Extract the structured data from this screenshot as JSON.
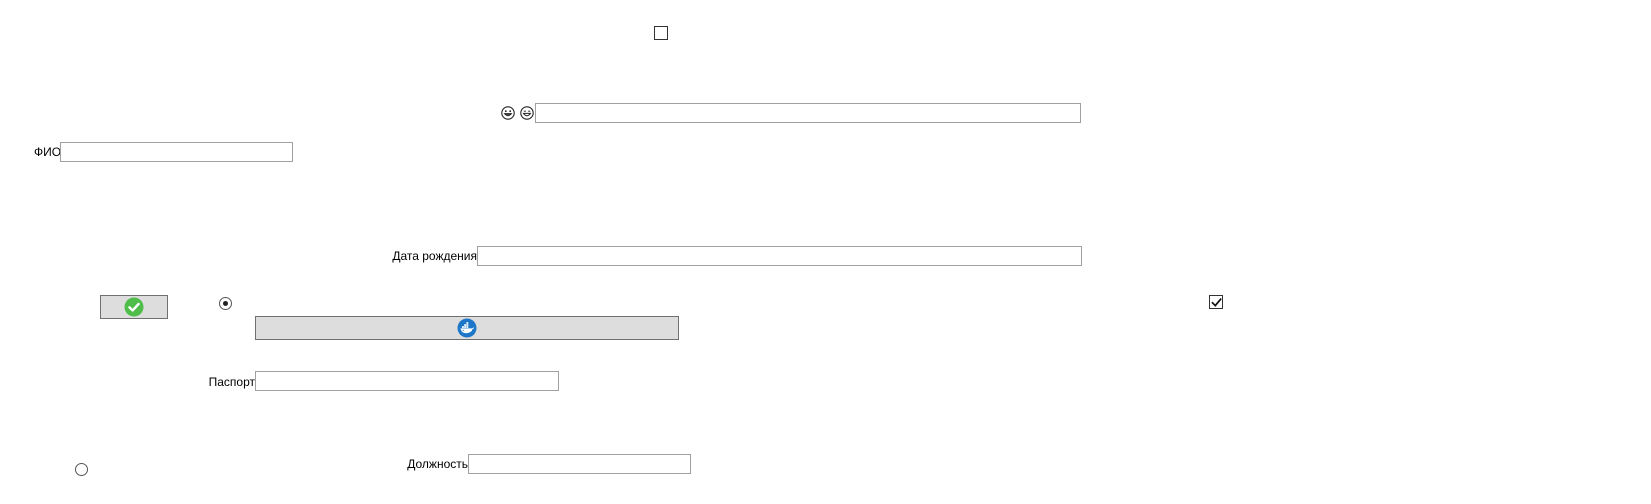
{
  "form": {
    "fio": {
      "label": "ФИО",
      "value": "",
      "placeholder": ""
    },
    "birth_date": {
      "label": "Дата рождения",
      "value": "",
      "placeholder": ""
    },
    "passport": {
      "label": "Паспорт",
      "value": "",
      "placeholder": ""
    },
    "position": {
      "label": "Должность",
      "value": "",
      "placeholder": ""
    },
    "top_text_field": {
      "value": "",
      "placeholder": ""
    }
  },
  "controls": {
    "top_checkbox": {
      "checked": false
    },
    "right_checkbox": {
      "checked": true
    },
    "radio_upper": {
      "selected": true
    },
    "radio_lower": {
      "selected": false
    }
  },
  "icons": {
    "emoji_grin": "grinning-face-icon",
    "emoji_smile": "smiling-face-icon",
    "confirm": "check-circle-icon",
    "docker": "docker-whale-icon"
  },
  "colors": {
    "button_bg": "#dddddd",
    "confirm_green": "#4fbd4a",
    "docker_blue": "#1d76c8",
    "field_border": "#a0a0a0"
  }
}
